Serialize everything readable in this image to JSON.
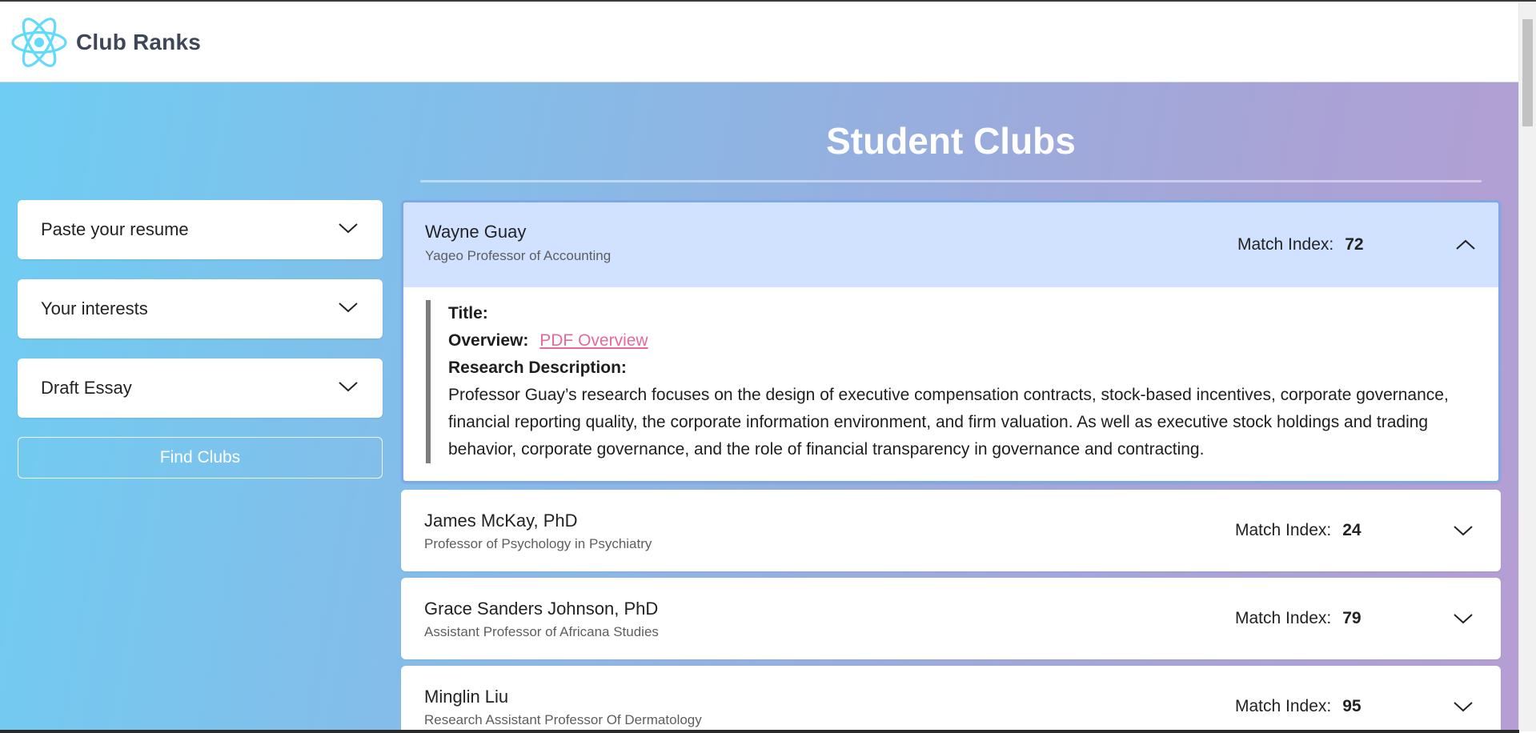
{
  "header": {
    "title": "Club Ranks",
    "logo": "atom-logo-icon"
  },
  "page": {
    "title": "Student Clubs"
  },
  "sidebar": {
    "dropdowns": [
      {
        "label": "Paste your resume",
        "icon": "chevron-down-icon"
      },
      {
        "label": "Your interests",
        "icon": "chevron-down-icon"
      },
      {
        "label": "Draft Essay",
        "icon": "chevron-down-icon"
      }
    ],
    "find_button": "Find Clubs"
  },
  "match_label": "Match Index:",
  "clubs": [
    {
      "name": "Wayne Guay",
      "role": "Yageo Professor of Accounting",
      "match": "72",
      "expanded": true,
      "details": {
        "title_label": "Title:",
        "overview_label": "Overview:",
        "overview_link": "PDF Overview",
        "research_label": "Research Description:",
        "description": "Professor Guay’s research focuses on the design of executive compensation contracts, stock-based incentives, corporate governance, financial reporting quality, the corporate information environment, and firm valuation. As well as executive stock holdings and trading behavior, corporate governance, and the role of financial transparency in governance and contracting."
      }
    },
    {
      "name": "James McKay, PhD",
      "role": "Professor of Psychology in Psychiatry",
      "match": "24",
      "expanded": false
    },
    {
      "name": "Grace Sanders Johnson, PhD",
      "role": "Assistant Professor of Africana Studies",
      "match": "79",
      "expanded": false
    },
    {
      "name": "Minglin Liu",
      "role": "Research Assistant Professor Of Dermatology",
      "match": "95",
      "expanded": false
    }
  ],
  "colors": {
    "accent_link": "#e5699c",
    "expanded_header": "#d0e2ff",
    "logo": "#61dafb",
    "gradient_start": "#6fcdf3",
    "gradient_end": "#b59ed3"
  }
}
